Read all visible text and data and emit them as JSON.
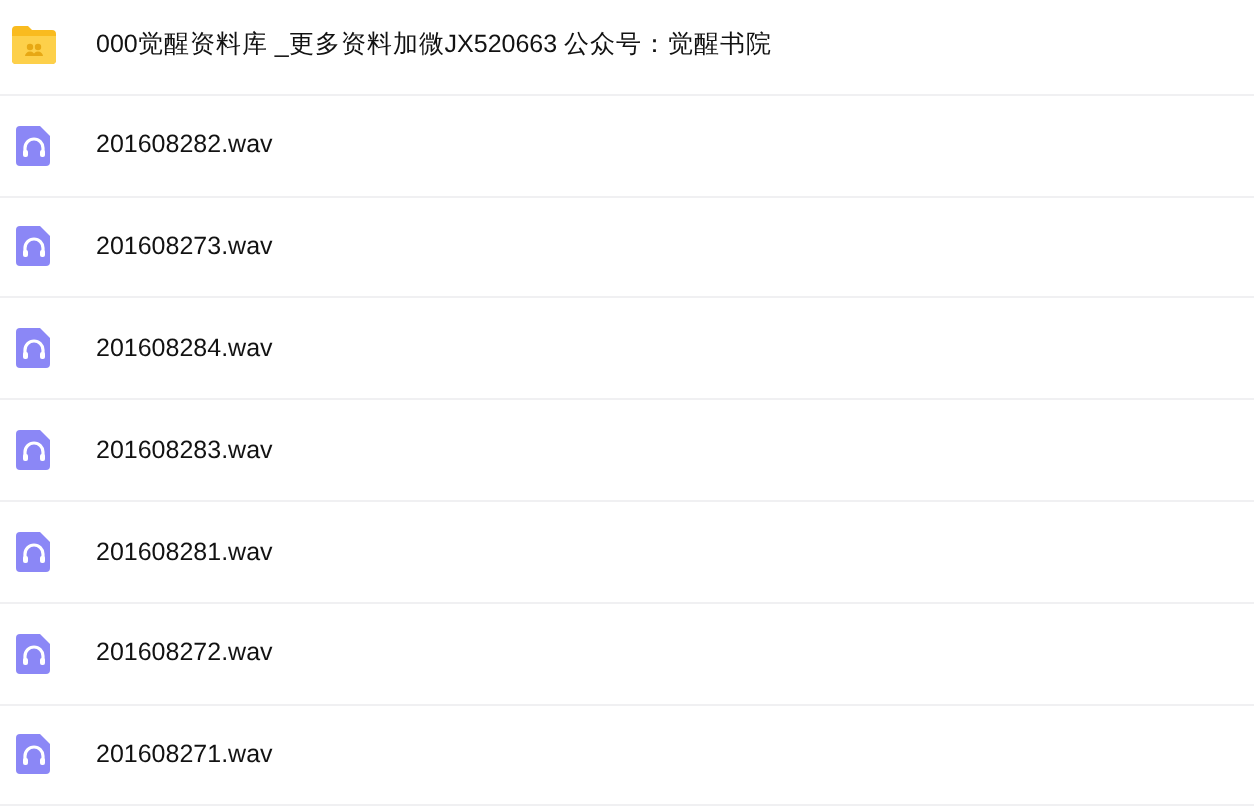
{
  "files": [
    {
      "kind": "folder",
      "name": "000觉醒资料库 _更多资料加微JX520663 公众号：觉醒书院"
    },
    {
      "kind": "audio",
      "name": "201608282.wav"
    },
    {
      "kind": "audio",
      "name": "201608273.wav"
    },
    {
      "kind": "audio",
      "name": "201608284.wav"
    },
    {
      "kind": "audio",
      "name": "201608283.wav"
    },
    {
      "kind": "audio",
      "name": "201608281.wav"
    },
    {
      "kind": "audio",
      "name": "201608272.wav"
    },
    {
      "kind": "audio",
      "name": "201608271.wav"
    }
  ]
}
